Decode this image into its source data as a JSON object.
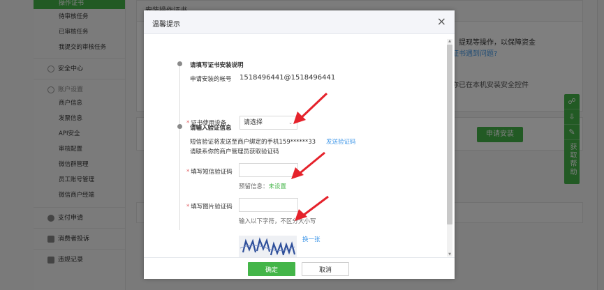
{
  "sidebar": {
    "active_item": "操作证书",
    "group1_items": [
      "待审核任务",
      "已审核任务",
      "我提交的审核任务"
    ],
    "security_center": "安全中心",
    "account_settings": "账户设置",
    "account_items": [
      "商户信息",
      "发票信息",
      "API安全",
      "审核配置",
      "微信群管理",
      "员工账号管理",
      "微信商户经端"
    ],
    "payment_apply": "支付申请",
    "consumer_complaint": "消费者投诉",
    "violation_record": "违规记录"
  },
  "background": {
    "panel_title": "安装操作证书",
    "text_line1": "、提现等操作，以保障资金",
    "link_line1": "证书遇到问题?",
    "text_line2": "你已在本机安装安全控件",
    "install_button": "申请安装"
  },
  "help_rail": {
    "text": "获取帮助"
  },
  "dialog": {
    "title": "温馨提示",
    "close": "×",
    "section1": {
      "title": "请填写证书安装说明",
      "account_label": "申请安装的帐号",
      "account_value": "1518496441@1518496441",
      "device_label": "证书使用设备",
      "device_value": "请选择"
    },
    "section2": {
      "title": "请输入验证信息",
      "sms_notice": "短信验证将发送至商户绑定的手机159******33",
      "send_sms_link": "发送验证码",
      "contact_notice": "请联系你的商户管理员获取验证码",
      "sms_label": "填写短信验证码",
      "reserved_label": "预留信息：",
      "reserved_value": "未设置",
      "captcha_label": "填写图片验证码",
      "captcha_hint": "输入以下字符，不区分大小写",
      "refresh_link": "换一张"
    },
    "required_mark": "*",
    "ok_button": "确定",
    "cancel_button": "取消"
  },
  "colors": {
    "brand_green": "#44b549",
    "link_blue": "#459ae9",
    "required_red": "#e15f63",
    "arrow_red": "#e5222b"
  }
}
